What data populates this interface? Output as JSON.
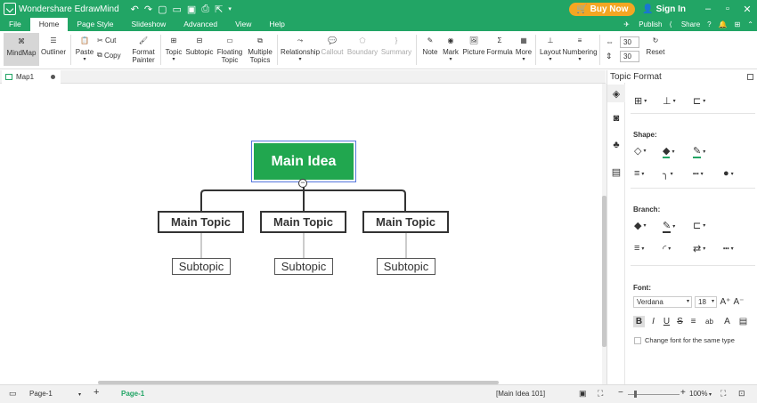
{
  "app": {
    "title": "Wondershare EdrawMind",
    "buy_now": "Buy Now",
    "sign_in": "Sign In"
  },
  "menu": {
    "items": [
      "File",
      "Home",
      "Page Style",
      "Slideshow",
      "Advanced",
      "View",
      "Help"
    ],
    "active": "Home",
    "publish": "Publish",
    "share": "Share"
  },
  "ribbon": {
    "mindmap": "MindMap",
    "outliner": "Outliner",
    "paste": "Paste",
    "cut": "Cut",
    "copy": "Copy",
    "format_painter_1": "Format",
    "format_painter_2": "Painter",
    "topic": "Topic",
    "subtopic": "Subtopic",
    "floating_topic_1": "Floating",
    "floating_topic_2": "Topic",
    "multiple_topics_1": "Multiple",
    "multiple_topics_2": "Topics",
    "relationship": "Relationship",
    "callout": "Callout",
    "boundary": "Boundary",
    "summary": "Summary",
    "note": "Note",
    "mark": "Mark",
    "picture": "Picture",
    "formula": "Formula",
    "more": "More",
    "layout": "Layout",
    "numbering": "Numbering",
    "spacing_h": "30",
    "spacing_v": "30",
    "reset": "Reset"
  },
  "doc_tab": "Map1",
  "mindmap": {
    "main_idea": "Main Idea",
    "topics": [
      "Main Topic",
      "Main Topic",
      "Main Topic"
    ],
    "subtopics": [
      "Subtopic",
      "Subtopic",
      "Subtopic"
    ],
    "colors": {
      "main_fill": "#21a74f",
      "line": "#333333",
      "selection": "#5577dd"
    }
  },
  "panel": {
    "title": "Topic Format",
    "shape_label": "Shape:",
    "branch_label": "Branch:",
    "font_label": "Font:",
    "font_family": "Verdana",
    "font_size": "18",
    "change_font_label": "Change font for the same type"
  },
  "status": {
    "page_select": "Page-1",
    "page_tab": "Page-1",
    "selection_info": "[Main Idea 101]",
    "zoom": "100%"
  },
  "accent_color": "#22a565",
  "buy_color": "#f5a623"
}
